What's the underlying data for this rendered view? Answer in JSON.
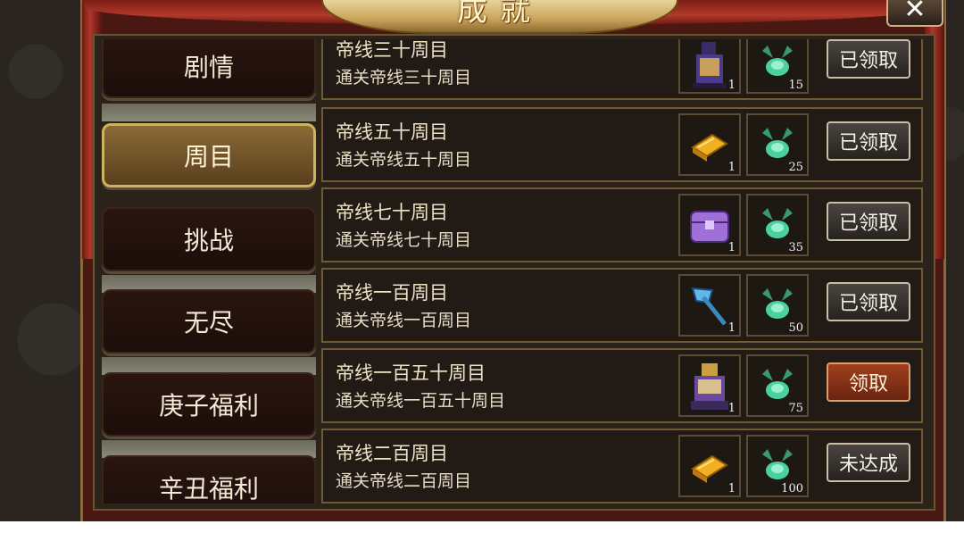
{
  "title": "成就",
  "close_label": "✕",
  "tabs": [
    {
      "label": "剧情",
      "active": false
    },
    {
      "label": "周目",
      "active": true
    },
    {
      "label": "挑战",
      "active": false
    },
    {
      "label": "无尽",
      "active": false
    },
    {
      "label": "庚子福利",
      "active": false
    },
    {
      "label": "辛丑福利",
      "active": false
    }
  ],
  "achievements": [
    {
      "name": "帝线三十周目",
      "desc": "通关帝线三十周目",
      "item1_icon": "general-figure-icon",
      "item1_qty": "1",
      "item2_icon": "jade-token-icon",
      "item2_qty": "15",
      "button": "已领取",
      "status": "claimed"
    },
    {
      "name": "帝线五十周目",
      "desc": "通关帝线五十周目",
      "item1_icon": "gold-book-icon",
      "item1_qty": "1",
      "item2_icon": "jade-token-icon",
      "item2_qty": "25",
      "button": "已领取",
      "status": "claimed"
    },
    {
      "name": "帝线七十周目",
      "desc": "通关帝线七十周目",
      "item1_icon": "purple-chest-icon",
      "item1_qty": "1",
      "item2_icon": "jade-token-icon",
      "item2_qty": "35",
      "button": "已领取",
      "status": "claimed"
    },
    {
      "name": "帝线一百周目",
      "desc": "通关帝线一百周目",
      "item1_icon": "blue-axe-icon",
      "item1_qty": "1",
      "item2_icon": "jade-token-icon",
      "item2_qty": "50",
      "button": "已领取",
      "status": "claimed"
    },
    {
      "name": "帝线一百五十周目",
      "desc": "通关帝线一百五十周目",
      "item1_icon": "armored-general-icon",
      "item1_qty": "1",
      "item2_icon": "jade-token-icon",
      "item2_qty": "75",
      "button": "领取",
      "status": "claimable"
    },
    {
      "name": "帝线二百周目",
      "desc": "通关帝线二百周目",
      "item1_icon": "gold-book-icon",
      "item1_qty": "1",
      "item2_icon": "jade-token-icon",
      "item2_qty": "100",
      "button": "未达成",
      "status": "locked"
    }
  ]
}
